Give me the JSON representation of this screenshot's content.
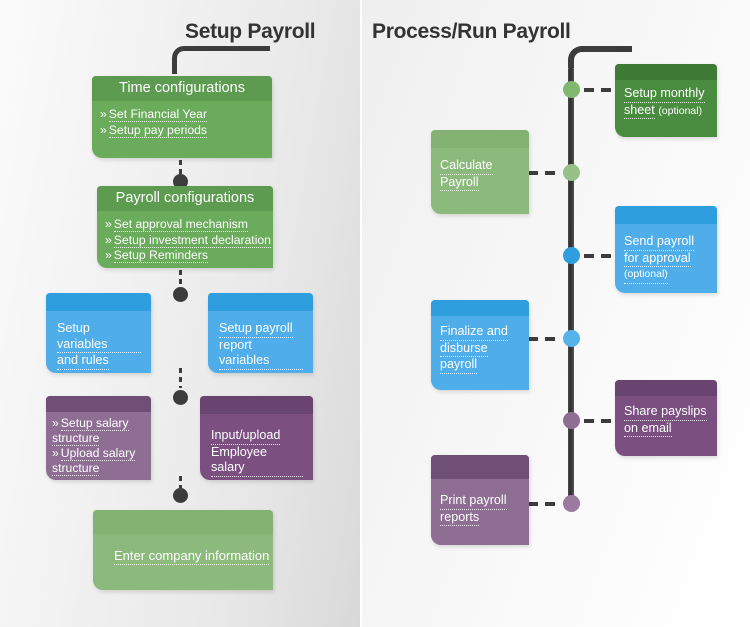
{
  "panels": {
    "left": {
      "title": "Setup Payroll"
    },
    "right": {
      "title": "Process/Run Payroll"
    }
  },
  "left_flow": {
    "cards": [
      {
        "id": "time-configurations",
        "header": "Time configurations",
        "items": [
          "Set Financial Year",
          "Setup pay periods"
        ],
        "color": "#6aab5c"
      },
      {
        "id": "payroll-configurations",
        "header": "Payroll configurations",
        "items": [
          "Set approval mechanism",
          "Setup investment declaration",
          "Setup Reminders"
        ],
        "color": "#6aab5c"
      },
      {
        "id": "setup-variables-and-rules",
        "lines": [
          "Setup variables",
          "and rules"
        ],
        "color": "#4fadea"
      },
      {
        "id": "setup-payroll-report-variables",
        "lines": [
          "Setup payroll",
          "report variables"
        ],
        "color": "#4fadea"
      },
      {
        "id": "salary-structure",
        "items": [
          "Setup salary structure",
          "Upload salary structure"
        ],
        "color": "#8e6e93"
      },
      {
        "id": "input-upload-employee-salary",
        "lines": [
          "Input/upload",
          "Employee salary"
        ],
        "color": "#7b4f80"
      },
      {
        "id": "enter-company-information",
        "lines": [
          "Enter company information"
        ],
        "color": "#8cba7c"
      }
    ]
  },
  "right_flow": {
    "steps": [
      {
        "id": "setup-monthly-sheet",
        "lines": [
          "Setup monthly",
          "sheet"
        ],
        "suffix": "(optional)",
        "side": "right",
        "color": "#4a8c3f",
        "node_color": "#7fb86e"
      },
      {
        "id": "calculate-payroll",
        "lines": [
          "Calculate",
          "Payroll"
        ],
        "side": "left",
        "color": "#8cba7c",
        "node_color": "#97c188"
      },
      {
        "id": "send-payroll-for-approval",
        "lines": [
          "Send payroll",
          "for approval"
        ],
        "suffix": "(optional)",
        "side": "right",
        "color": "#4fadea",
        "node_color": "#2f9ede"
      },
      {
        "id": "finalize-and-disburse-payroll",
        "lines": [
          "Finalize and",
          "disburse",
          "payroll"
        ],
        "side": "left",
        "color": "#4fadea",
        "node_color": "#56b3ea"
      },
      {
        "id": "share-payslips-on-email",
        "lines": [
          "Share payslips",
          "on email"
        ],
        "side": "right",
        "color": "#7b4f80",
        "node_color": "#8e6e93"
      },
      {
        "id": "print-payroll-reports",
        "lines": [
          "Print payroll",
          "reports"
        ],
        "side": "left",
        "color": "#8e6e93",
        "node_color": "#9a7a9f"
      }
    ]
  },
  "symbols": {
    "bullet": "»"
  }
}
